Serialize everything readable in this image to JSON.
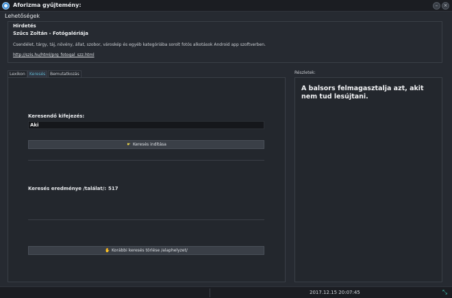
{
  "window": {
    "title": "Aforizma gyűjtemény:",
    "minimize_glyph": "–",
    "close_glyph": "×"
  },
  "menu": {
    "items": [
      "Lehetőségek"
    ]
  },
  "ad": {
    "heading": "Hirdetés",
    "title": "Szűcs Zoltán - Fotógalériája",
    "description": "Csendélet, tárgy, táj, növény, állat, szobor, városkép és egyéb kategóriába sorolt fotós alkotások Android app szoftverben.",
    "link": "http://szis.hu/html/prg_fotogal_szz.html"
  },
  "tabs": [
    {
      "label": "Lexikon",
      "active": false
    },
    {
      "label": "Keresés",
      "active": true
    },
    {
      "label": "Bemutatkozás",
      "active": false
    }
  ],
  "search": {
    "label": "Keresendő kifejezés:",
    "value": "Aki",
    "start_button": "Keresés indítása",
    "result_label": "Keresés eredménye /találat/:",
    "result_count": "517",
    "reset_button": "Korábbi keresés törlése /alaphelyzet/"
  },
  "details": {
    "label": "Részletek:",
    "quote": "A balsors felmagasztalja azt, akit nem tud lesújtani."
  },
  "status": {
    "timestamp": "2017.12.15 20:07:45"
  },
  "icons": {
    "app": "app-icon",
    "search_button": "hand-point-icon",
    "reset_button": "hand-icon",
    "resize": "resize-grip-icon"
  },
  "colors": {
    "background": "#262a31",
    "titlebar": "#1b1d22",
    "active_tab": "#5fb2c8",
    "accent_resize": "#3fb8a8"
  }
}
